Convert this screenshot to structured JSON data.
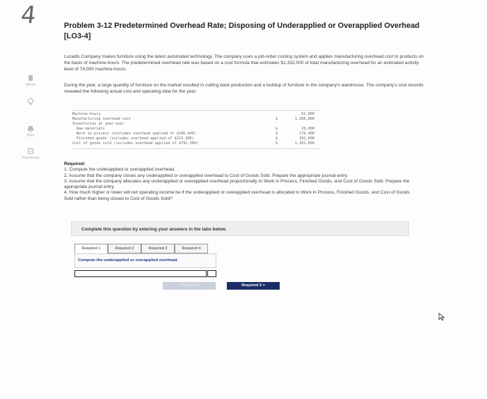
{
  "page_number": "4",
  "problem_title": "Problem 3-12 Predetermined Overhead Rate; Disposing of Underapplied or Overapplied Overhead [LO3-4]",
  "intro_paragraph": "Luzadis Company makes furniture using the latest automated technology. The company uses a job-order costing system and applies manufacturing overhead cost to products on the basis of machine-hours. The predetermined overhead rate was based on a cost formula that estimates $1,332,000 of total manufacturing overhead for an estimated activity level of 74,000 machine-hours.",
  "year_paragraph": "During the year, a large quantity of furniture on the market resulted in cutting back production and a buildup of furniture in the company's warehouse. The company's cost records revealed the following actual cost and operating data for the year:",
  "left_rail": {
    "ebook": "eBook",
    "print": "Print",
    "references": "References"
  },
  "cost_data": [
    {
      "label": "Machine-hours",
      "currency": "",
      "amount": "62,000"
    },
    {
      "label": "Manufacturing overhead cost",
      "currency": "$",
      "amount": "1,300,000"
    },
    {
      "label": "Inventories at year-end:",
      "currency": "",
      "amount": ""
    },
    {
      "label": "  Raw materials",
      "currency": "$",
      "amount": "20,000"
    },
    {
      "label": "  Work in process (includes overhead applied of $100,440)",
      "currency": "$",
      "amount": "176,400"
    },
    {
      "label": "  Finished goods (includes overhead applied of $223,200)",
      "currency": "$",
      "amount": "392,000"
    },
    {
      "label": "Cost of goods sold (includes overhead applied of $792,360)",
      "currency": "$",
      "amount": "1,391,600"
    }
  ],
  "required": {
    "heading": "Required:",
    "items": [
      "1. Compute the underapplied or overapplied overhead.",
      "2. Assume that the company closes any underapplied or overapplied overhead to Cost of Goods Sold. Prepare the appropriate journal entry.",
      "3. Assume that the company allocates any underapplied or overapplied overhead proportionally to Work in Process, Finished Goods, and Cost of Goods Sold. Prepare the appropriate journal entry.",
      "4. How much higher or lower will net operating income be if the underapplied or overapplied overhead is allocated to Work in Process, Finished Goods, and Cost of Goods Sold rather than being closed to Cost of Goods Sold?"
    ]
  },
  "complete_banner": "Complete this question by entering your answers in the tabs below.",
  "tabs": [
    "Required 1",
    "Required 2",
    "Required 3",
    "Required 4"
  ],
  "tab_instruction": "Compute the underapplied or overapplied overhead.",
  "answer_value": "",
  "nav": {
    "prev_label": "< Required 1",
    "next_label": "Required 2  >"
  },
  "colors": {
    "next_button": "#1b2f66",
    "prev_button": "#c8d0dc",
    "instruction_text": "#1a3a8a"
  }
}
